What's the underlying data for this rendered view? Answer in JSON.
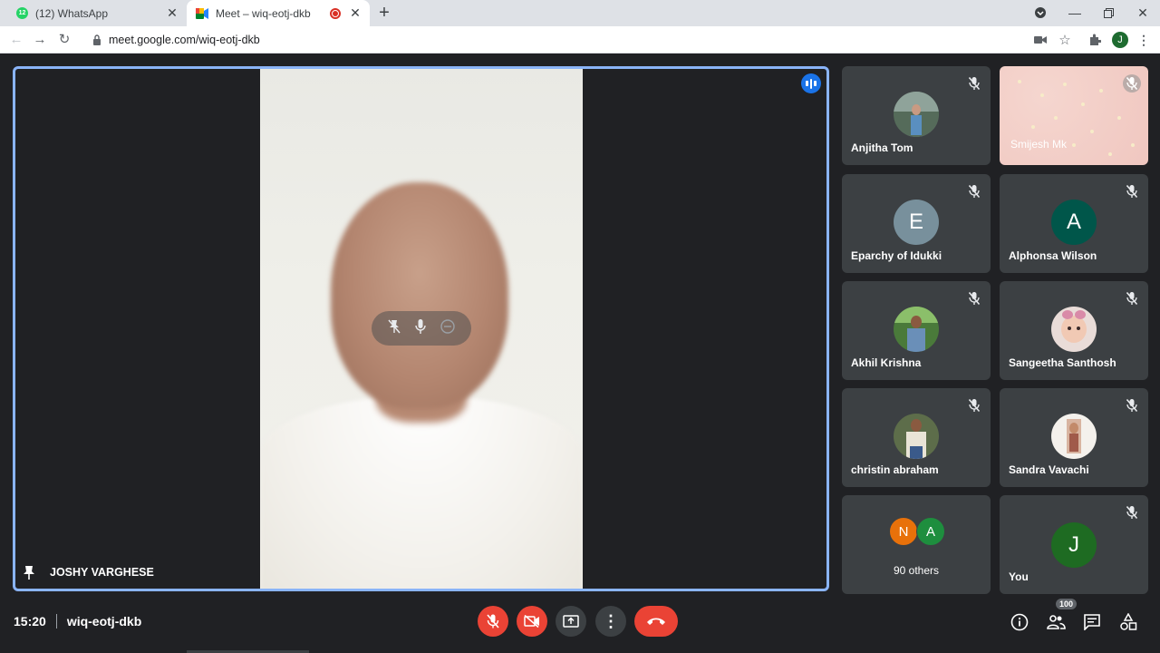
{
  "browser": {
    "tabs": [
      {
        "title": "(12) WhatsApp",
        "badge": "12"
      },
      {
        "title": "Meet – wiq-eotj-dkb",
        "active": true,
        "recording": true
      }
    ],
    "url": "meet.google.com/wiq-eotj-dkb",
    "profile_initial": "J"
  },
  "meeting": {
    "time": "15:20",
    "code": "wiq-eotj-dkb",
    "participant_count": "100",
    "main_speaker": "JOSHY VARGHESE",
    "tiles": [
      {
        "name": "Anjitha Tom",
        "kind": "photo",
        "muted": true
      },
      {
        "name": "Smijesh Mk",
        "kind": "video",
        "muted": true
      },
      {
        "name": "Eparchy of Idukki",
        "kind": "letter",
        "initial": "E",
        "color": "#78909c",
        "muted": true
      },
      {
        "name": "Alphonsa Wilson",
        "kind": "letter",
        "initial": "A",
        "color": "#00564a",
        "muted": true
      },
      {
        "name": "Akhil Krishna",
        "kind": "photo",
        "muted": true
      },
      {
        "name": "Sangeetha Santhosh",
        "kind": "photo",
        "muted": true
      },
      {
        "name": "christin abraham",
        "kind": "photo",
        "muted": true
      },
      {
        "name": "Sandra Vavachi",
        "kind": "photo",
        "muted": true
      },
      {
        "name": "90 others",
        "kind": "others",
        "initials": [
          "N",
          "A"
        ],
        "colors": [
          "#e8710a",
          "#1e8e3e"
        ]
      },
      {
        "name": "You",
        "kind": "letter",
        "initial": "J",
        "color": "#1e6b22",
        "muted": true
      }
    ]
  }
}
